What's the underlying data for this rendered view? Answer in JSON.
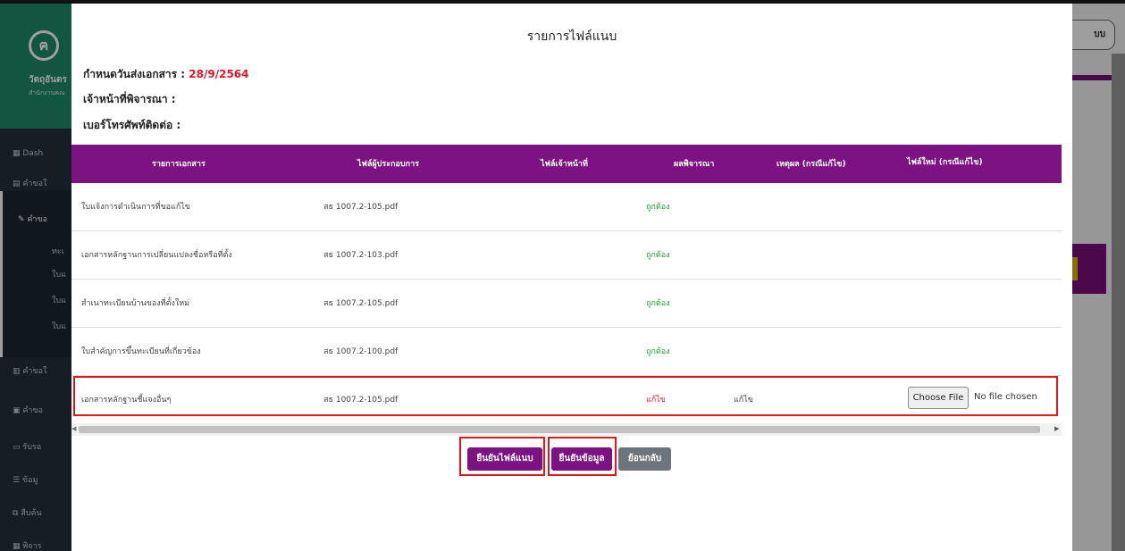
{
  "background": {
    "brand_logo": "ฅ",
    "brand_name": "วัตถุอันตร",
    "brand_sub": "สำนักงานคณ",
    "nav_items": [
      "Dash",
      "คำขอใ",
      "คำขอ",
      "ทะเ",
      "ใบแ",
      "ใบแ",
      "ใบแ",
      "คำขอใ",
      "คำขอ",
      "รับรอ",
      "ข้อมู",
      "สืบค้น",
      "พิจาร"
    ],
    "right_button_label": "บบ"
  },
  "modal": {
    "title": "รายการไฟล์แนบ",
    "due_label": "กำหนดวันส่งเอกสาร : ",
    "due_date": "28/9/2564",
    "officer_label": "เจ้าหน้าที่พิจารณา :",
    "phone_label": "เบอร์โทรศัพท์ติดต่อ :"
  },
  "table": {
    "headers": [
      "รายการเอกสาร",
      "ไฟล์ผู้ประกอบการ",
      "ไฟล์เจ้าหน้าที่",
      "ผลพิจารณา",
      "เหตุผล (กรณีแก้ไข)",
      "ไฟล์ใหม่ (กรณีแก้ไข)"
    ],
    "rows": [
      {
        "doc": "ใบแจ้งการดำเนินการที่ขอแก้ไข",
        "file": "สธ 1007.2-105.pdf",
        "result": "ถูกต้อง",
        "reason": ""
      },
      {
        "doc": "เอกสารหลักฐานการเปลี่ยนแปลงชื่อหรือที่ตั้ง",
        "file": "สธ 1007.2-103.pdf",
        "result": "ถูกต้อง",
        "reason": ""
      },
      {
        "doc": "สำเนาทะเบียนบ้านของที่ตั้งใหม่",
        "file": "สธ 1007.2-105.pdf",
        "result": "ถูกต้อง",
        "reason": ""
      },
      {
        "doc": "ใบสำคัญการขึ้นทะเบียนที่เกี่ยวข้อง",
        "file": "สธ 1007.2-100.pdf",
        "result": "ถูกต้อง",
        "reason": ""
      },
      {
        "doc": "เอกสารหลักฐานชี้แจงอื่นๆ",
        "file": "สธ 1007.2-105.pdf",
        "result": "แก้ไข",
        "reason": "แก้ไข",
        "choose_file": "Choose File",
        "file_status": "No file chosen"
      }
    ]
  },
  "buttons": {
    "confirm_attachments": "ยืนยันไฟล์แนบ",
    "confirm_data": "ยืนยันข้อมูล",
    "back": "ย้อนกลับ"
  },
  "colors": {
    "header_purple": "#7d1282",
    "status_ok": "#1f9d3a",
    "status_fix": "#e0162b",
    "highlight": "#e5161b"
  }
}
